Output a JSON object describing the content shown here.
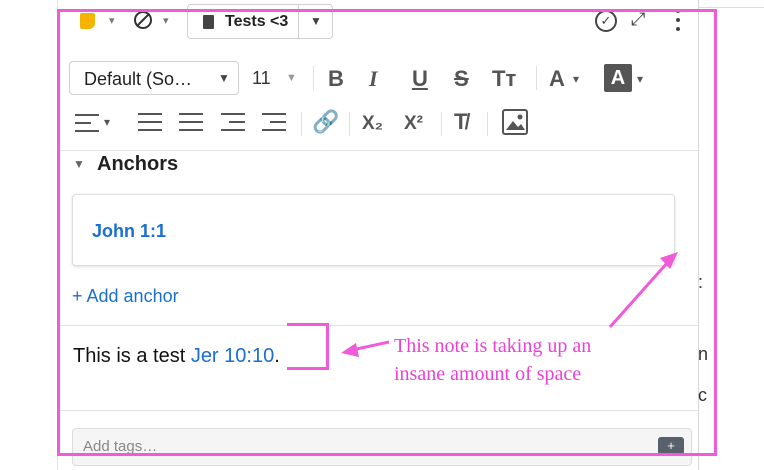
{
  "topbar": {
    "notebook_name": "Tests <3",
    "chevron": "⌄",
    "check_glyph": "✓",
    "expand_glyph": "⤢"
  },
  "toolbar": {
    "font_family": "Default (So…",
    "font_size": "11",
    "bold": "B",
    "italic": "I",
    "underline": "U",
    "strike": "S",
    "text_size": "Tт",
    "font_color": "A",
    "highlight": "A",
    "subscript": "X₂",
    "superscript": "X²",
    "clear_format": "T̸"
  },
  "anchors": {
    "section_title": "Anchors",
    "items": [
      "John 1:1"
    ],
    "add_label": "+ Add anchor"
  },
  "note": {
    "text": "This is a test ",
    "link": "Jer 10:10",
    "suffix": "."
  },
  "tags": {
    "placeholder": "Add tags…"
  },
  "annotation": {
    "line1": "This note is taking up an",
    "line2": "insane amount of space",
    "color": "#f05bd8"
  }
}
